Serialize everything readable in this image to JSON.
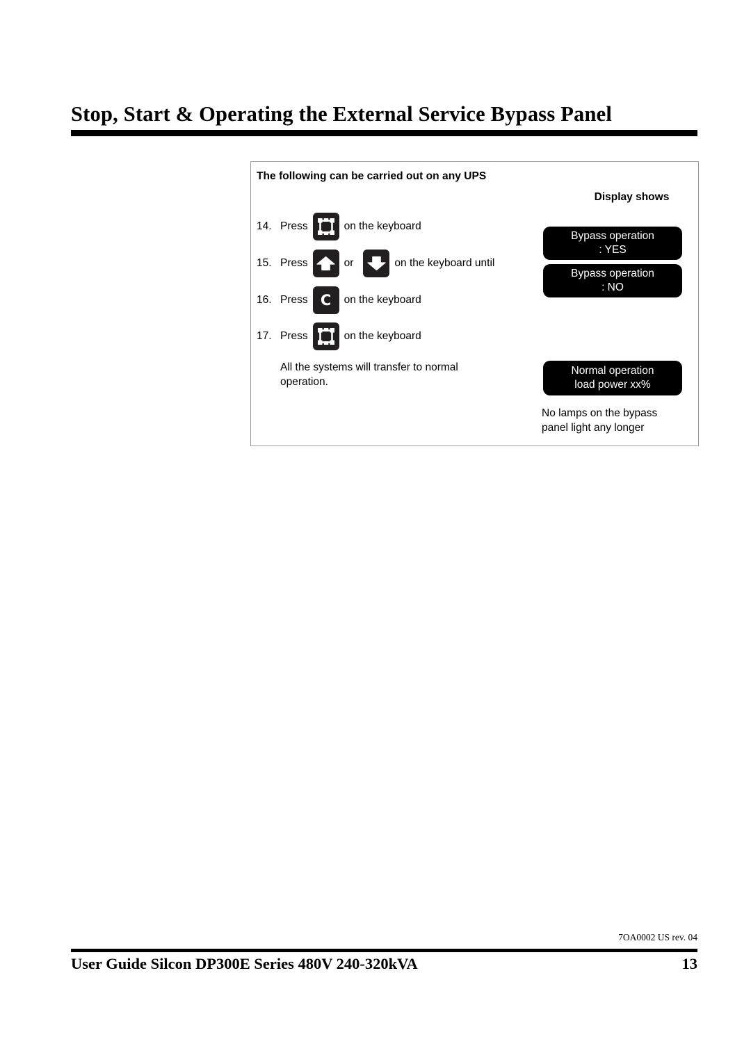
{
  "page": {
    "title": "Stop, Start & Operating the External Service Bypass Panel"
  },
  "panel": {
    "heading": "The following can be carried out on any UPS",
    "display_column_label": "Display shows",
    "steps": [
      {
        "number": "14.",
        "press_label": "Press",
        "key": "display-key",
        "tail": "on the keyboard"
      },
      {
        "number": "15.",
        "press_label": "Press",
        "key": "up-arrow-key",
        "conjunction": "or",
        "key2": "down-arrow-key",
        "tail": "on the keyboard until"
      },
      {
        "number": "16.",
        "press_label": "Press",
        "key": "c-key",
        "key_glyph": "C",
        "tail": "on the keyboard"
      },
      {
        "number": "17.",
        "press_label": "Press",
        "key": "display-key",
        "tail": "on the keyboard"
      }
    ],
    "body_note": "All the systems will transfer to normal\noperation.",
    "displays": [
      {
        "line1": "Bypass operation",
        "line2": ": YES"
      },
      {
        "line1": "Bypass operation",
        "line2": ": NO"
      },
      {
        "line1": "Normal operation",
        "line2": "load power xx%"
      }
    ],
    "display_note": "No lamps on the bypass\npanel light any longer"
  },
  "footer": {
    "revision": "7OA0002 US rev. 04",
    "guide_title": "User Guide Silcon DP300E Series 480V 240-320kVA",
    "page_number": "13"
  },
  "colors": {
    "key_fill": "#231f20",
    "display_fill": "#000000",
    "box_border": "#9a9a9a",
    "rule": "#000000"
  }
}
